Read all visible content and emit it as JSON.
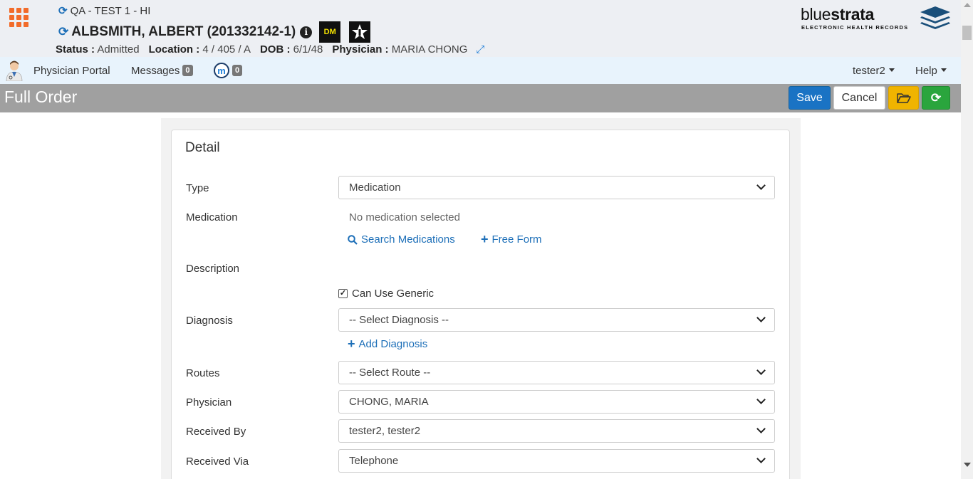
{
  "header": {
    "facility": "QA - TEST 1 - HI",
    "patient_name": "ALBSMITH, ALBERT (201332142-1)",
    "badge_dm": "DM",
    "status": {
      "label": "Status :",
      "value": "Admitted"
    },
    "location": {
      "label": "Location :",
      "value": "4 / 405 / A"
    },
    "dob": {
      "label": "DOB :",
      "value": "6/1/48"
    },
    "physician": {
      "label": "Physician :",
      "value": "MARIA CHONG"
    },
    "logo": {
      "name_light": "blue",
      "name_bold": "strata",
      "tagline": "ELECTRONIC HEALTH RECORDS"
    }
  },
  "nav": {
    "physician_portal": "Physician Portal",
    "messages": "Messages",
    "messages_count": "0",
    "m_count": "0",
    "m_letter": "m",
    "user": "tester2",
    "help": "Help"
  },
  "titlebar": {
    "title": "Full Order",
    "save": "Save",
    "cancel": "Cancel"
  },
  "form": {
    "panel_title": "Detail",
    "type": {
      "label": "Type",
      "value": "Medication"
    },
    "medication": {
      "label": "Medication",
      "value": "No medication selected",
      "search_link": "Search Medications",
      "free_form_link": "Free Form"
    },
    "description": {
      "label": "Description"
    },
    "generic": {
      "label": "Can Use Generic",
      "checked": true
    },
    "diagnosis": {
      "label": "Diagnosis",
      "value": "-- Select Diagnosis --",
      "add_link": "Add Diagnosis"
    },
    "routes": {
      "label": "Routes",
      "value": "-- Select Route --"
    },
    "physician": {
      "label": "Physician",
      "value": "CHONG, MARIA"
    },
    "received_by": {
      "label": "Received By",
      "value": "tester2, tester2"
    },
    "received_via": {
      "label": "Received Via",
      "value": "Telephone"
    }
  },
  "icons": [
    "apps-grid-icon",
    "refresh-icon",
    "info-icon",
    "star-badge-icon",
    "expand-icon",
    "doctor-avatar-icon",
    "folder-open-icon",
    "search-icon",
    "plus-icon",
    "chevron-down-icon"
  ],
  "colors": {
    "accent": "#1a73c4",
    "warning": "#f0b400",
    "success": "#2aa53d",
    "apps": "#f26b2a",
    "titlebar": "#a0a0a0",
    "navbar": "#e8f3fc"
  }
}
